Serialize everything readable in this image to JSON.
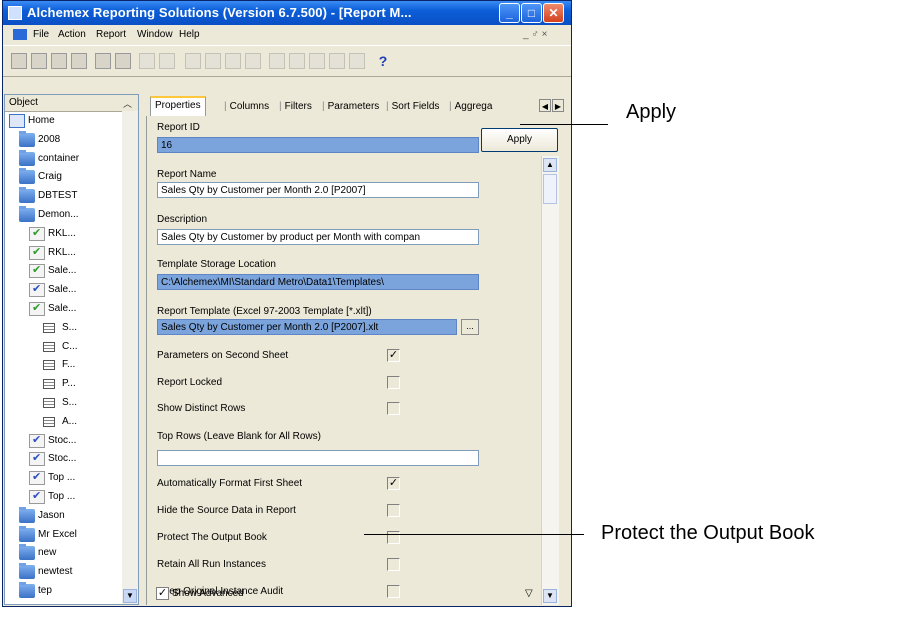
{
  "window": {
    "title": "Alchemex Reporting Solutions (Version 6.7.500) - [Report M...",
    "controls": {
      "minimize": "_",
      "maximize": "□",
      "close": "✕"
    }
  },
  "menu": {
    "items": [
      "File",
      "Action",
      "Report",
      "Window",
      "Help"
    ],
    "mdi_controls": "_ ♂ ×"
  },
  "toolbar": {
    "help_icon": "?"
  },
  "tree": {
    "header": "Object",
    "items": [
      {
        "label": "Home",
        "icon": "home-icon"
      },
      {
        "label": "2008",
        "icon": "folder-icon"
      },
      {
        "label": "container",
        "icon": "folder-icon"
      },
      {
        "label": "Craig",
        "icon": "folder-icon"
      },
      {
        "label": "DBTEST",
        "icon": "folder-icon"
      },
      {
        "label": "Demon...",
        "icon": "folder-icon"
      },
      {
        "label": "RKL...",
        "icon": "report-icon"
      },
      {
        "label": "RKL...",
        "icon": "report-icon"
      },
      {
        "label": "Sale...",
        "icon": "report-icon"
      },
      {
        "label": "Sale...",
        "icon": "report-icon"
      },
      {
        "label": "Sale...",
        "icon": "report-icon"
      },
      {
        "label": "S...",
        "icon": "grid-icon"
      },
      {
        "label": "C...",
        "icon": "grid-icon"
      },
      {
        "label": "F...",
        "icon": "grid-icon"
      },
      {
        "label": "P...",
        "icon": "grid-icon"
      },
      {
        "label": "S...",
        "icon": "grid-icon"
      },
      {
        "label": "A...",
        "icon": "grid-icon"
      },
      {
        "label": "Stoc...",
        "icon": "report-icon"
      },
      {
        "label": "Stoc...",
        "icon": "report-icon"
      },
      {
        "label": "Top ...",
        "icon": "report-icon"
      },
      {
        "label": "Top ...",
        "icon": "report-icon"
      },
      {
        "label": "Jason",
        "icon": "folder-icon"
      },
      {
        "label": "Mr Excel",
        "icon": "folder-icon"
      },
      {
        "label": "new",
        "icon": "folder-icon"
      },
      {
        "label": "newtest",
        "icon": "folder-icon"
      },
      {
        "label": "tep",
        "icon": "folder-icon"
      }
    ]
  },
  "tabs": [
    "Properties",
    "Columns",
    "Filters",
    "Parameters",
    "Sort Fields",
    "Aggrega"
  ],
  "properties": {
    "report_id_label": "Report ID",
    "report_id_value": "16",
    "report_name_label": "Report Name",
    "report_name_value": "Sales Qty by Customer per Month 2.0 [P2007]",
    "description_label": "Description",
    "description_value": "Sales Qty by Customer by product per Month with compan",
    "template_location_label": "Template Storage Location",
    "template_location_value": "C:\\Alchemex\\MI\\Standard Metro\\Data1\\Templates\\",
    "report_template_label": "Report Template (Excel 97-2003 Template [*.xlt])",
    "report_template_value": "Sales Qty by Customer per Month 2.0 [P2007].xlt",
    "browse_label": "...",
    "parameters_second_sheet_label": "Parameters on Second Sheet",
    "report_locked_label": "Report Locked",
    "show_distinct_rows_label": "Show Distinct Rows",
    "top_rows_label": "Top Rows (Leave Blank for All Rows)",
    "top_rows_value": "",
    "auto_format_label": "Automatically Format First Sheet",
    "hide_source_label": "Hide the Source Data in Report",
    "protect_output_label": "Protect The Output Book",
    "retain_instances_label": "Retain All Run Instances",
    "keep_audit_label": "Keep Original Instance Audit",
    "show_advanced_label": "Show Advanced",
    "checks": {
      "parameters_second_sheet": "✓",
      "report_locked": "",
      "show_distinct_rows": "",
      "auto_format": "✓",
      "hide_source": "",
      "protect_output": "",
      "retain_instances": "",
      "keep_audit": "",
      "show_advanced": "✓"
    }
  },
  "apply_button": "Apply",
  "callouts": {
    "apply": "Apply",
    "protect": "Protect the Output Book"
  }
}
